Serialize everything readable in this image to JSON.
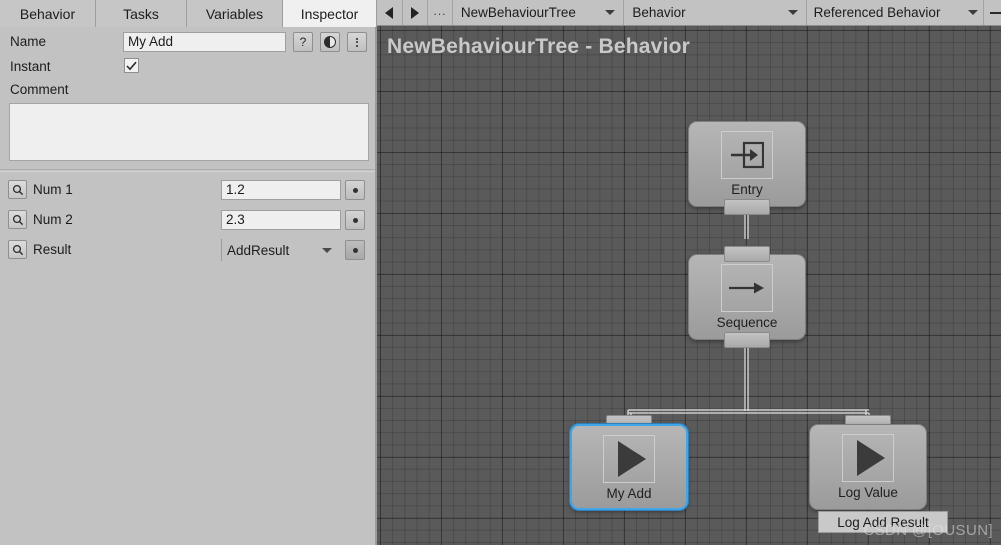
{
  "tabs": [
    {
      "label": "Behavior",
      "active": false
    },
    {
      "label": "Tasks",
      "active": false
    },
    {
      "label": "Variables",
      "active": false
    },
    {
      "label": "Inspector",
      "active": true
    }
  ],
  "inspector": {
    "name_label": "Name",
    "name_value": "My Add",
    "help_button": "?",
    "instant_label": "Instant",
    "instant_checked": true,
    "comment_label": "Comment",
    "comment_value": "",
    "fields": [
      {
        "label": "Num 1",
        "value": "1.2",
        "type": "text"
      },
      {
        "label": "Num 2",
        "value": "2.3",
        "type": "text"
      },
      {
        "label": "Result",
        "value": "AddResult",
        "type": "dropdown"
      }
    ]
  },
  "toolbar": {
    "more_label": "...",
    "tree_dropdown": "NewBehaviourTree",
    "behavior_dropdown": "Behavior",
    "referenced_behavior_dropdown": "Referenced Behavior"
  },
  "graph": {
    "title": "NewBehaviourTree - Behavior",
    "nodes": [
      {
        "label": "Entry",
        "icon": "enter-arrow-icon",
        "selected": false
      },
      {
        "label": "Sequence",
        "icon": "right-arrow-icon",
        "selected": false
      },
      {
        "label": "My Add",
        "icon": "play-icon",
        "selected": true
      },
      {
        "label": "Log Value",
        "icon": "play-icon",
        "selected": false
      }
    ],
    "tooltip": "Log Add Result",
    "watermark": "CSDN @[OUSUN]"
  },
  "colors": {
    "panel": "#c2c2c2",
    "canvas": "#5a5a5a",
    "selection": "#41a6e8",
    "field": "#efefef"
  }
}
